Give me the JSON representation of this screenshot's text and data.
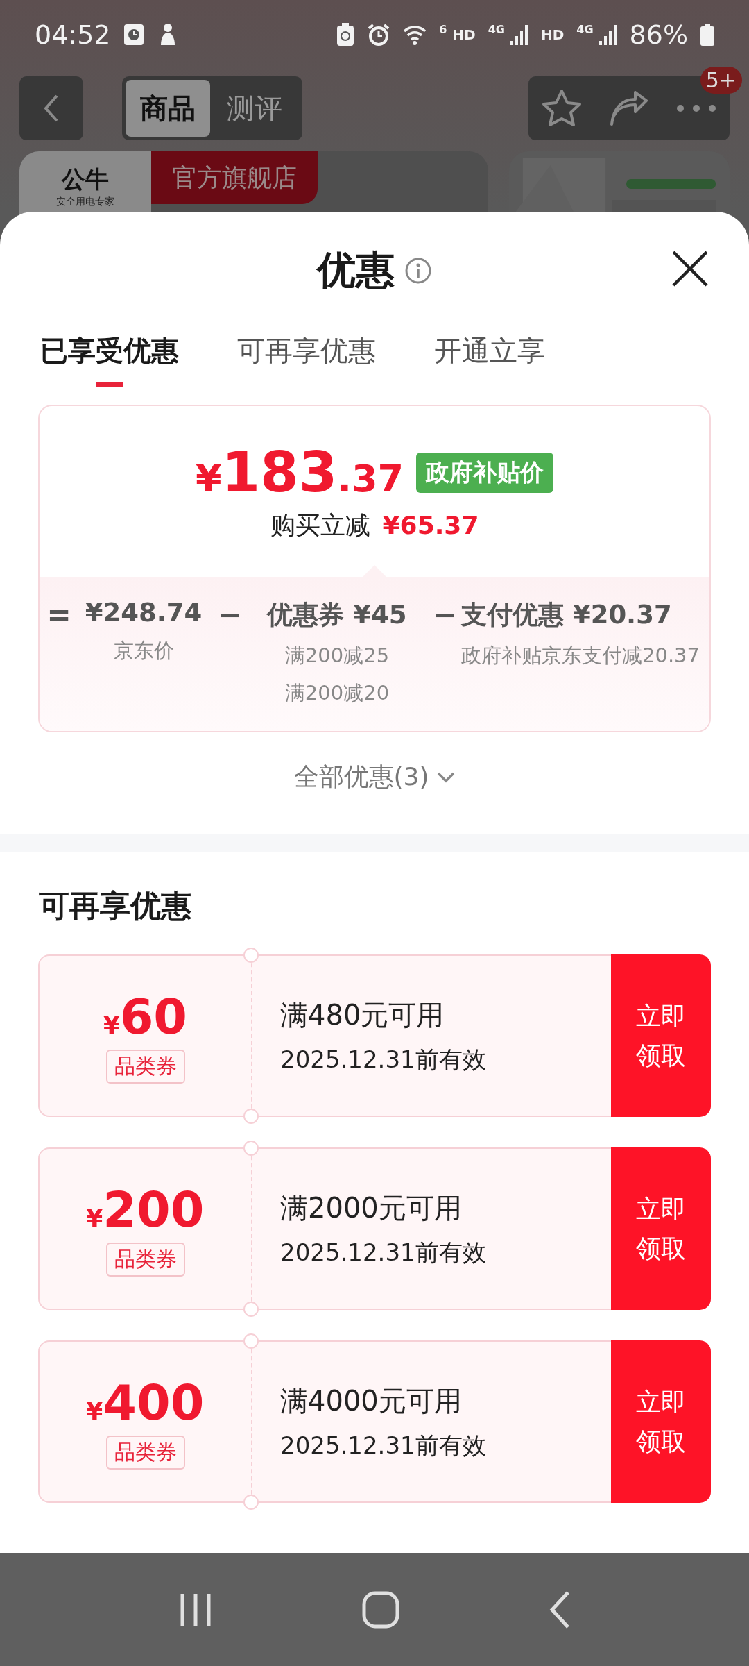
{
  "status_bar": {
    "time": "04:52",
    "wifi_label": "6",
    "signals": [
      {
        "hd": "HD",
        "gen": "4G"
      },
      {
        "hd": "HD",
        "gen": "4G"
      }
    ],
    "battery": "86%"
  },
  "header": {
    "tabs": [
      {
        "label": "商品",
        "selected": true
      },
      {
        "label": "测评",
        "selected": false
      }
    ],
    "badge": "5+"
  },
  "store": {
    "logo_name": "公牛",
    "logo_tagline": "安全用电专家",
    "badge": "官方旗舰店"
  },
  "sheet": {
    "title": "优惠",
    "tabs": [
      {
        "label": "已享受优惠",
        "selected": true
      },
      {
        "label": "可再享优惠",
        "selected": false
      },
      {
        "label": "开通立享",
        "selected": false
      }
    ],
    "summary": {
      "currency": "¥",
      "integer": "183",
      "decimal": ".37",
      "tag": "政府补贴价",
      "saving_label": "购买立减",
      "saving": "¥65.37"
    },
    "breakdown": [
      {
        "operator": "=",
        "value": "¥248.74",
        "notes": [
          "京东价"
        ]
      },
      {
        "operator": "−",
        "label": "优惠券",
        "value": "¥45",
        "notes": [
          "满200减25",
          "满200减20"
        ]
      },
      {
        "operator": "−",
        "label": "支付优惠",
        "value": "¥20.37",
        "notes": [
          "政府补贴京东支付减20.37"
        ]
      }
    ],
    "more_link": "全部优惠(3)",
    "section_title": "可再享优惠",
    "coupons": [
      {
        "currency": "¥",
        "amount": "60",
        "type": "品类券",
        "condition": "满480元可用",
        "validity": "2025.12.31前有效",
        "button": "立即领取"
      },
      {
        "currency": "¥",
        "amount": "200",
        "type": "品类券",
        "condition": "满2000元可用",
        "validity": "2025.12.31前有效",
        "button": "立即领取"
      },
      {
        "currency": "¥",
        "amount": "400",
        "type": "品类券",
        "condition": "满4000元可用",
        "validity": "2025.12.31前有效",
        "button": "立即领取"
      }
    ]
  }
}
